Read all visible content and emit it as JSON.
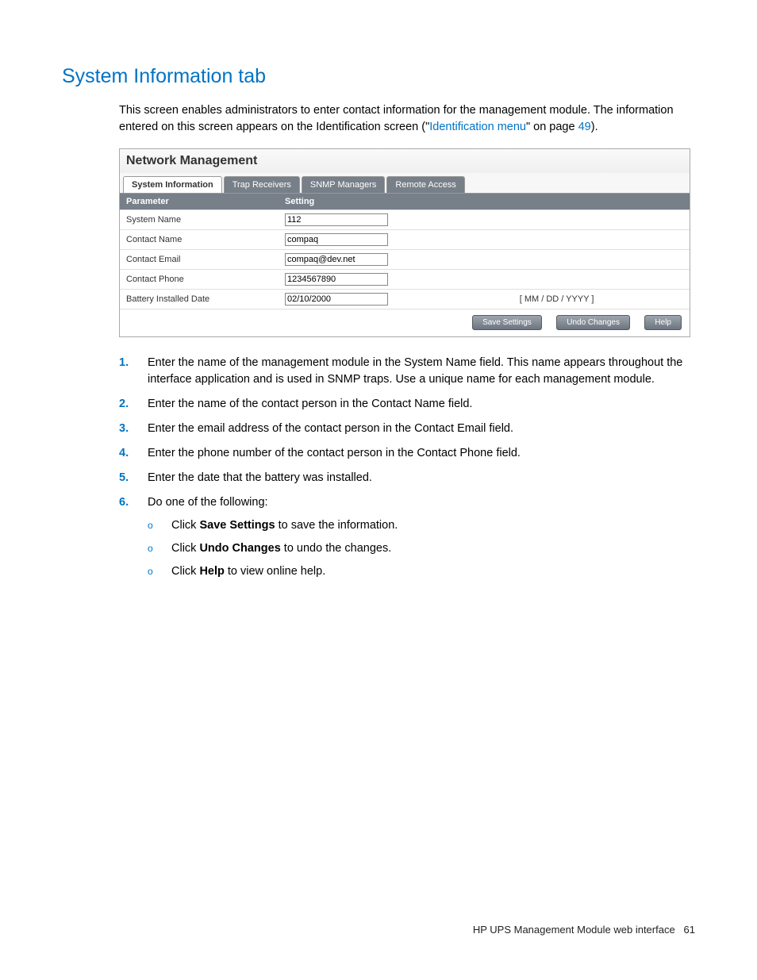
{
  "heading": "System Information tab",
  "intro_parts": {
    "pre": "This screen enables administrators to enter contact information for the management module. The information entered on this screen appears on the Identification screen (\"",
    "link": "Identification menu",
    "post1": "\" on page ",
    "page_ref": "49",
    "post2": ")."
  },
  "screenshot": {
    "title": "Network Management",
    "tabs": [
      {
        "label": "System Information",
        "active": true
      },
      {
        "label": "Trap Receivers",
        "active": false
      },
      {
        "label": "SNMP Managers",
        "active": false
      },
      {
        "label": "Remote Access",
        "active": false
      }
    ],
    "columns": {
      "parameter": "Parameter",
      "setting": "Setting"
    },
    "rows": [
      {
        "param": "System Name",
        "value": "112",
        "hint": ""
      },
      {
        "param": "Contact Name",
        "value": "compaq",
        "hint": ""
      },
      {
        "param": "Contact Email",
        "value": "compaq@dev.net",
        "hint": ""
      },
      {
        "param": "Contact Phone",
        "value": "1234567890",
        "hint": ""
      },
      {
        "param": "Battery Installed Date",
        "value": "02/10/2000",
        "hint": "[ MM / DD / YYYY ]"
      }
    ],
    "buttons": {
      "save": "Save Settings",
      "undo": "Undo Changes",
      "help": "Help"
    }
  },
  "steps": [
    "Enter the name of the management module in the System Name field. This name appears throughout the interface application and is used in SNMP traps. Use a unique name for each management module.",
    "Enter the name of the contact person in the Contact Name field.",
    "Enter the email address of the contact person in the Contact Email field.",
    "Enter the phone number of the contact person in the Contact Phone field.",
    "Enter the date that the battery was installed."
  ],
  "step6": {
    "text": "Do one of the following:",
    "subs": [
      {
        "pre": "Click ",
        "bold": "Save Settings",
        "post": " to save the information."
      },
      {
        "pre": "Click ",
        "bold": "Undo Changes",
        "post": " to undo the changes."
      },
      {
        "pre": "Click ",
        "bold": "Help",
        "post": " to view online help."
      }
    ]
  },
  "footer": {
    "text": "HP UPS Management Module web interface",
    "page": "61"
  }
}
